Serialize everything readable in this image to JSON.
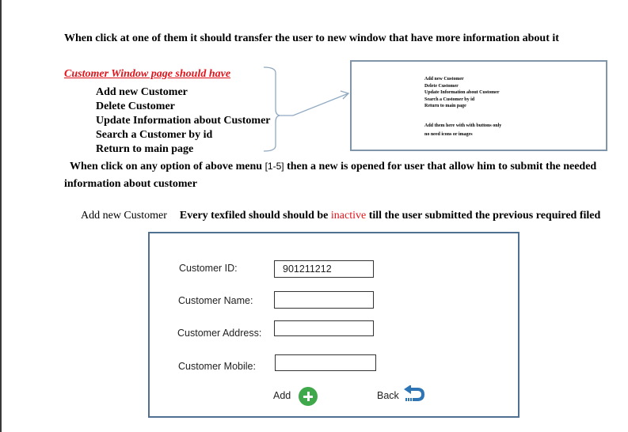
{
  "intro_text": "When click at one of them it should transfer the user to new window that have more information about it",
  "customer_window": {
    "heading": "Customer Window  page  should have",
    "menu_items": [
      "Add new Customer",
      "Delete Customer",
      "Update Information about Customer",
      "Search a Customer by id",
      "Return to main page"
    ]
  },
  "mockup": {
    "items": [
      "Add new Customer",
      "Delete Customer",
      "Update Information about Customer",
      "Search a Customer by id",
      "Return to main page"
    ],
    "note_line1": "Add them here with with buttons only",
    "note_line2": "no need icons or images"
  },
  "paragraph2": {
    "part1": "When click on   any option of above menu ",
    "range": "[1-5]",
    "part2": "  then a new is opened for user that allow him to submit the needed information about customer"
  },
  "paragraph3": {
    "title": "Add new Customer",
    "part1": "Every texfiled should should be ",
    "highlight": "inactive",
    "part2": " till the user submitted the previous required filed"
  },
  "colors": {
    "red_accent": "#e0151b",
    "add_green": "#3ea84a",
    "back_blue": "#2e75b6",
    "box_border": "#4f7090"
  },
  "form": {
    "fields": [
      {
        "label": "Customer ID:",
        "value": "901211212"
      },
      {
        "label": "Customer Name:",
        "value": ""
      },
      {
        "label": "Customer Address:",
        "value": ""
      },
      {
        "label": "Customer Mobile:",
        "value": ""
      }
    ],
    "add_label": "Add",
    "back_label": "Back"
  }
}
